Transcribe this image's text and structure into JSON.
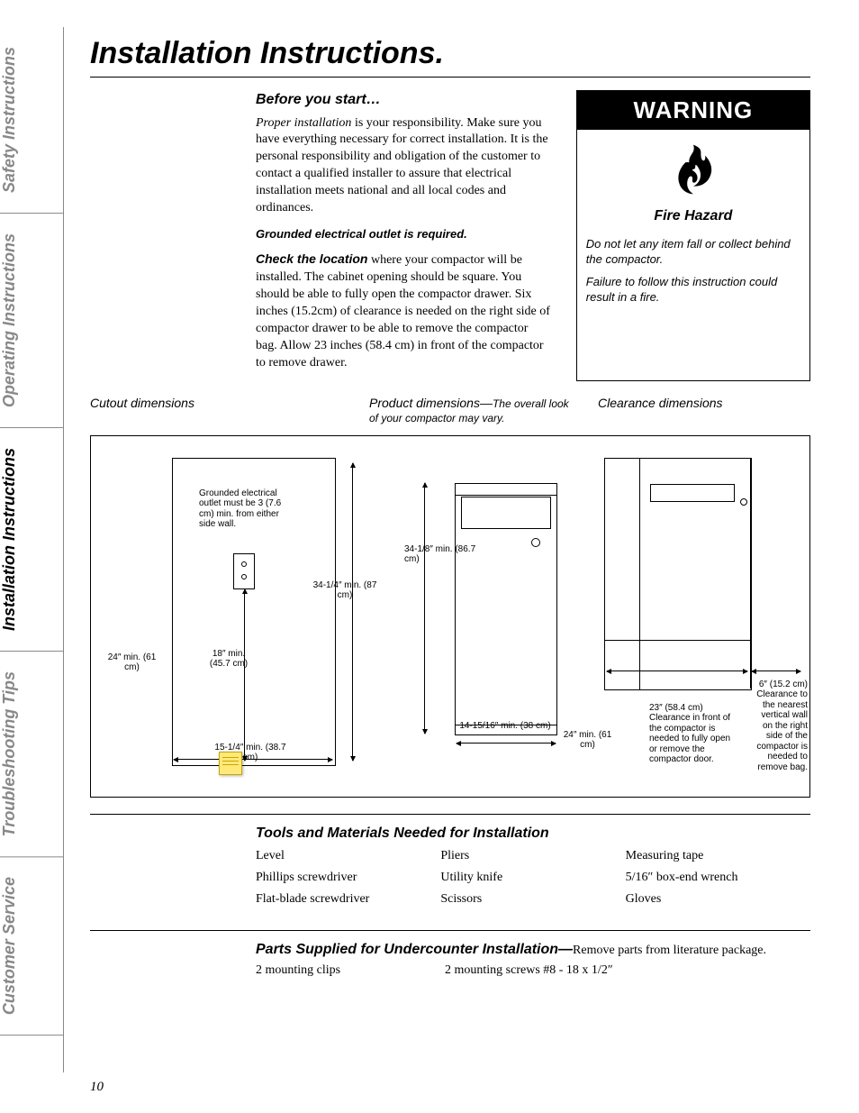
{
  "sideTabs": {
    "safety": "Safety Instructions",
    "operating": "Operating Instructions",
    "installation": "Installation Instructions",
    "troubleshooting": "Troubleshooting Tips",
    "customer": "Customer Service"
  },
  "title": "Installation Instructions.",
  "intro": {
    "heading": "Before you start…",
    "p1_lead": "Proper installation",
    "p1_rest": " is your responsibility. Make sure you have everything necessary for correct installation. It is the personal responsibility and obligation of the customer to contact a qualified installer to assure that electrical installation meets national and all local codes and ordinances.",
    "grounded": "Grounded electrical outlet is required.",
    "p2_lead": "Check the location",
    "p2_rest": "  where your compactor will be installed. The cabinet opening should be square. You should be able to fully open the compactor drawer. Six inches (15.2cm) of clearance is needed on the right side of compactor drawer to be able to remove the compactor bag. Allow 23 inches (58.4 cm) in front of the compactor to remove drawer."
  },
  "warning": {
    "header": "WARNING",
    "fireLabel": "Fire Hazard",
    "line1": "Do not let any item fall or collect behind the compactor.",
    "line2": "Failure to follow this instruction could result in a fire."
  },
  "dimsHeadings": {
    "cutout": "Cutout dimensions",
    "product_lead": "Product dimensions—",
    "product_sub": "The overall look of your compactor may vary.",
    "clearance": "Clearance dimensions"
  },
  "diagram": {
    "cutout": {
      "outletLabel": "Grounded electrical outlet must be 3 (7.6 cm) min. from either side wall.",
      "dim_height": "34-1/4″ min. (87 cm)",
      "dim_upper": "18″ min. (45.7 cm)",
      "dim_left": "24″ min. (61 cm)",
      "dim_width": "15-1/4″ min. (38.7 cm)"
    },
    "product": {
      "height": "34-1/8″ min. (86.7 cm)",
      "width": "14-15/16″ min. (38 cm)",
      "depth": "24″ min. (61 cm)"
    },
    "clearance": {
      "front": "23″ (58.4 cm) Clearance in front of the compactor is needed to fully open or remove the compactor door.",
      "side": "6″ (15.2 cm) Clearance to the nearest vertical wall on the right side of the compactor is needed to remove bag."
    }
  },
  "tools": {
    "heading": "Tools and Materials Needed for Installation",
    "col1": [
      "Level",
      "Phillips screwdriver",
      "Flat-blade screwdriver"
    ],
    "col2": [
      "Pliers",
      "Utility knife",
      "Scissors"
    ],
    "col3": [
      "Measuring tape",
      "5/16″ box-end wrench",
      "Gloves"
    ]
  },
  "parts": {
    "heading_lead": "Parts Supplied for Undercounter Installation—",
    "heading_rest": "Remove parts from literature package.",
    "col1": "2 mounting clips",
    "col2": "2 mounting screws #8 - 18 x 1/2″"
  },
  "pageNum": "10"
}
